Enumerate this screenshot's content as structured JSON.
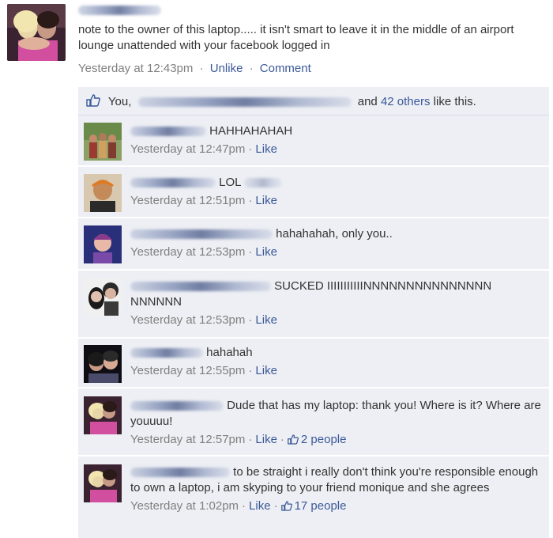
{
  "post": {
    "text": "note to the owner of this laptop..... it isn't smart to leave it in the middle of an airport lounge unattended with your facebook logged in",
    "time": "Yesterday at 12:43pm",
    "unlike_label": "Unlike",
    "comment_label": "Comment"
  },
  "likes": {
    "you": "You,",
    "and_text": "and",
    "others_link": "42 others",
    "suffix": "like this."
  },
  "comments": [
    {
      "text": "HAHHAHAHAH",
      "time": "Yesterday at 12:47pm",
      "like_label": "Like"
    },
    {
      "text": "LOL",
      "time": "Yesterday at 12:51pm",
      "like_label": "Like"
    },
    {
      "text": "hahahahah, only you..",
      "time": "Yesterday at 12:53pm",
      "like_label": "Like"
    },
    {
      "text": "SUCKED IIIIIIIIIIINNNNNNNNNNNNNNN NNNNNN",
      "time": "Yesterday at 12:53pm",
      "like_label": "Like"
    },
    {
      "text": "hahahah",
      "time": "Yesterday at 12:55pm",
      "like_label": "Like"
    },
    {
      "text": "Dude that has my laptop: thank you! Where is it? Where are youuuu!",
      "time": "Yesterday at 12:57pm",
      "like_label": "Like",
      "likes_count": "2 people"
    },
    {
      "text": "to be straight i really don't think you're responsible enough to own a laptop, i am skyping to your friend monique and she agrees",
      "time": "Yesterday at 1:02pm",
      "like_label": "Like",
      "likes_count": "17 people"
    }
  ],
  "colors": {
    "link": "#3b5998",
    "comment_bg": "#edeff4",
    "meta": "#808080"
  }
}
